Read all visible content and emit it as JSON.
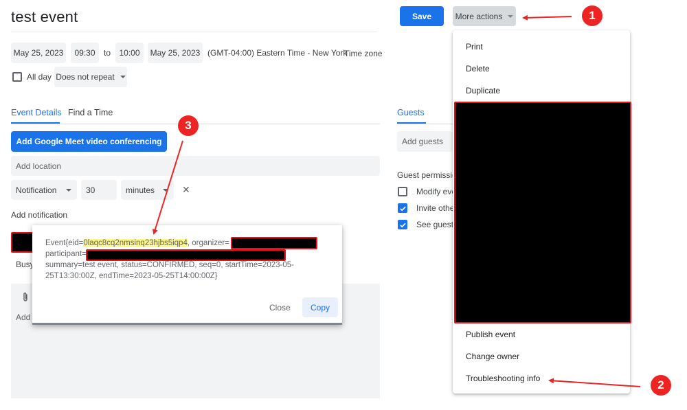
{
  "event": {
    "title": "test event",
    "start_date": "May 25, 2023",
    "start_time": "09:30",
    "to_label": "to",
    "end_time": "10:00",
    "end_date": "May 25, 2023",
    "timezone_display": "(GMT-04:00) Eastern Time - New York",
    "timezone_button": "Time zone",
    "all_day_label": "All day",
    "repeat_value": "Does not repeat"
  },
  "tabs": {
    "details": "Event Details",
    "find_time": "Find a Time",
    "guests": "Guests"
  },
  "details": {
    "meet_button": "Add Google Meet video conferencing",
    "location_placeholder": "Add location",
    "notification_type": "Notification",
    "notification_amount": "30",
    "notification_unit": "minutes",
    "remove_symbol": "✕",
    "add_notification": "Add notification",
    "busy_label": "Busy",
    "description_add": "Add"
  },
  "guests": {
    "add_placeholder": "Add guests",
    "permissions_title": "Guest permissio",
    "permissions": [
      {
        "label": "Modify eve",
        "checked": false
      },
      {
        "label": "Invite othe",
        "checked": true
      },
      {
        "label": "See guest",
        "checked": true
      }
    ]
  },
  "actions": {
    "save": "Save",
    "more_actions": "More actions"
  },
  "menu": {
    "items_top": [
      "Print",
      "Delete",
      "Duplicate"
    ],
    "items_bottom": [
      "Publish event",
      "Change owner",
      "Troubleshooting info"
    ]
  },
  "dialog": {
    "line1_prefix": "Event{eid=",
    "eid": "0laqc8cq2nmsinq23hjbs5iqp4",
    "line1_suffix": ", organizer=",
    "line2": "participant=",
    "line3": "summary=test event, status=CONFIRMED, seq=0, startTime=2023-05-",
    "line4": "25T13:30:00Z, endTime=2023-05-25T14:00:00Z}",
    "close": "Close",
    "copy": "Copy"
  },
  "annotations": {
    "badge1": "1",
    "badge2": "2",
    "badge3": "3",
    "color": "#ec2424"
  },
  "colors": {
    "primary": "#1a73e8",
    "redaction_border": "#e8111c",
    "highlight": "#fef88a"
  }
}
